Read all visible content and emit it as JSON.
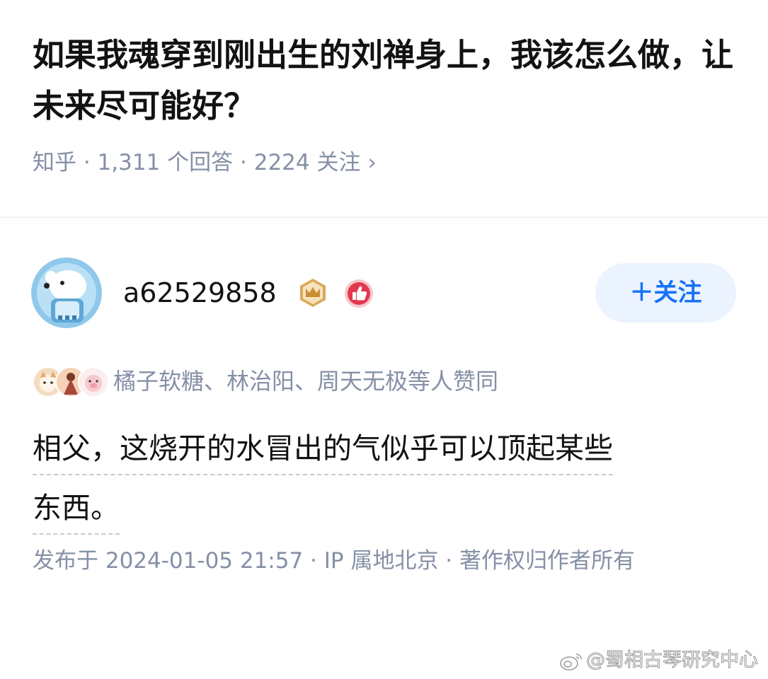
{
  "question": {
    "title": "如果我魂穿到刚出生的刘禅身上，我该怎么做，让未来尽可能好？",
    "meta": "知乎 · 1,311 个回答 · 2224 关注",
    "chevron": "›"
  },
  "author": {
    "name": "a62529858",
    "avatar_icon": "polar-bear-avatar-icon",
    "badges": [
      "crown-badge-icon",
      "thumbs-up-badge-icon"
    ],
    "follow_label": "＋关注"
  },
  "voters": {
    "text": "橘子软糖、林治阳、周天无极等人赞同",
    "avatars": [
      "voter-avatar-1",
      "voter-avatar-2",
      "voter-avatar-3"
    ]
  },
  "answer": {
    "lines": [
      "相父，这烧开的水冒出的气似乎可以顶起某些",
      "东西。"
    ],
    "meta": "发布于 2024-01-05 21:57 · IP 属地北京 · 著作权归作者所有"
  },
  "watermark": {
    "text": "@蜀相古琴研究中心",
    "icon": "weibo-icon"
  },
  "colors": {
    "accent": "#1772f6",
    "follow_bg": "#ebf3ff",
    "muted": "#8590a6",
    "text": "#121212"
  }
}
